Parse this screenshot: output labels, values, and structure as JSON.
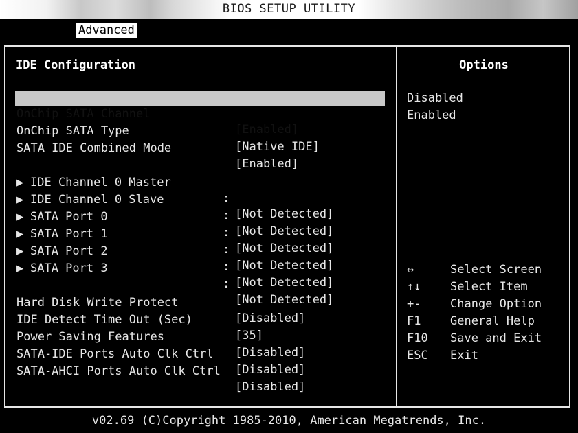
{
  "title": "BIOS SETUP UTILITY",
  "tab": "Advanced",
  "section_title": "IDE Configuration",
  "options_title": "Options",
  "settings": [
    {
      "label": "OnChip SATA Channel",
      "value": "[Enabled]",
      "selected": true
    },
    {
      "label": "OnChip SATA Type",
      "value": "[Native IDE]"
    },
    {
      "label": "SATA IDE Combined Mode",
      "value": "[Enabled]"
    }
  ],
  "submenus": [
    {
      "label": "IDE Channel 0 Master",
      "value": "[Not Detected]"
    },
    {
      "label": "IDE Channel 0 Slave",
      "value": "[Not Detected]"
    },
    {
      "label": "SATA Port 0",
      "value": "[Not Detected]"
    },
    {
      "label": "SATA Port 1",
      "value": "[Not Detected]"
    },
    {
      "label": "SATA Port 2",
      "value": "[Not Detected]"
    },
    {
      "label": "SATA Port 3",
      "value": "[Not Detected]"
    }
  ],
  "submenu_marker": "▶",
  "submenu_colon": ":",
  "settings2": [
    {
      "label": "Hard Disk Write Protect",
      "value": "[Disabled]"
    },
    {
      "label": "IDE Detect Time Out (Sec)",
      "value": "[35]"
    },
    {
      "label": "Power Saving Features",
      "value": "[Disabled]"
    },
    {
      "label": "SATA-IDE Ports Auto Clk Ctrl",
      "value": "[Disabled]"
    },
    {
      "label": "SATA-AHCI Ports Auto Clk Ctrl",
      "value": "[Disabled]"
    }
  ],
  "options": [
    "Disabled",
    "Enabled"
  ],
  "help": [
    {
      "key": "↔",
      "desc": "Select Screen",
      "icon": "left-right-arrow-icon"
    },
    {
      "key": "↑↓",
      "desc": "Select Item",
      "icon": "up-down-arrow-icon"
    },
    {
      "key": "+-",
      "desc": "Change Option",
      "icon": "plus-minus-icon"
    },
    {
      "key": "F1",
      "desc": "General Help"
    },
    {
      "key": "F10",
      "desc": "Save and Exit"
    },
    {
      "key": "ESC",
      "desc": "Exit"
    }
  ],
  "footer": "v02.69 (C)Copyright 1985-2010, American Megatrends, Inc.",
  "colors": {
    "background": "#000000",
    "text": "#e6e6e6",
    "highlight": "#c8c8c8"
  }
}
